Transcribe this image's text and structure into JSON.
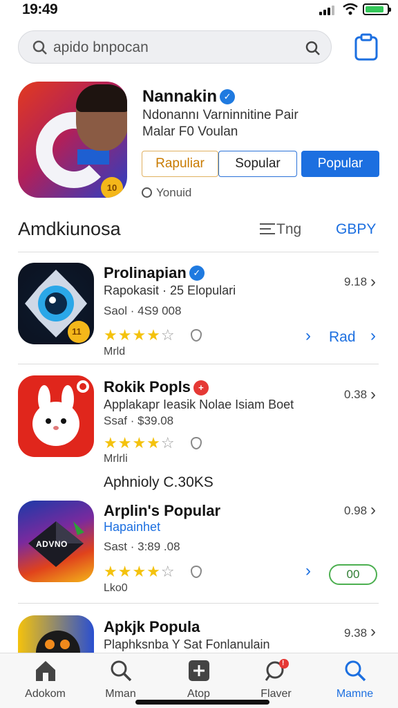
{
  "status": {
    "time": "19:49"
  },
  "search": {
    "placeholder": "apido bnpocan"
  },
  "featured": {
    "title": "Nannakin",
    "subtitle1": "Ndonannı Varninnitine Pair",
    "subtitle2": "Malar F0 Voulan",
    "icon_badge": "10",
    "segments": [
      "Rapuliar",
      "Sopular",
      "Popular"
    ],
    "footer": "Yonuid"
  },
  "section": {
    "title": "Amdkiunosa",
    "sort_label": "Tng",
    "link_label": "GBPY"
  },
  "apps": [
    {
      "name": "Prolinapian",
      "badge": "verified",
      "desc": "Rapokasit · 25 Elopulari",
      "price": "Saol · 4S9 008",
      "rating": 4,
      "tag": "Mrld",
      "size": "9.18",
      "action_label": "Rad",
      "icon_badge": "11"
    },
    {
      "name": "Rokik Popls",
      "badge": "red",
      "desc": "Applakapr Ieasik Nolae Isiam Boet",
      "price": "Ssaf · $39.08",
      "rating": 4,
      "tag": "Mrlrli",
      "size": "0.38"
    },
    {
      "name": "Arplin's Popular",
      "desc": "Hapainhet",
      "price": "Sast · 3:89 .08",
      "rating": 4,
      "tag": "Lko0",
      "size": "0.98",
      "pill_label": "00",
      "icon_text": "ADVNO"
    },
    {
      "name": "Apkjk Popula",
      "desc": "Plaphksnba Y Sat Fonlanulain",
      "size": "9.38"
    }
  ],
  "between_text": "Aphnioly C.30KS",
  "tabs": [
    {
      "label": "Adokom",
      "icon": "home-icon"
    },
    {
      "label": "Mman",
      "icon": "search-icon"
    },
    {
      "label": "Atop",
      "icon": "plus-square-icon"
    },
    {
      "label": "Flaver",
      "icon": "notification-icon",
      "badge": "!"
    },
    {
      "label": "Mamne",
      "icon": "search-icon",
      "active": true
    }
  ],
  "colors": {
    "accent": "#1c6fe0",
    "star": "#f4c20d",
    "green": "#4caf50",
    "red": "#e53935"
  }
}
